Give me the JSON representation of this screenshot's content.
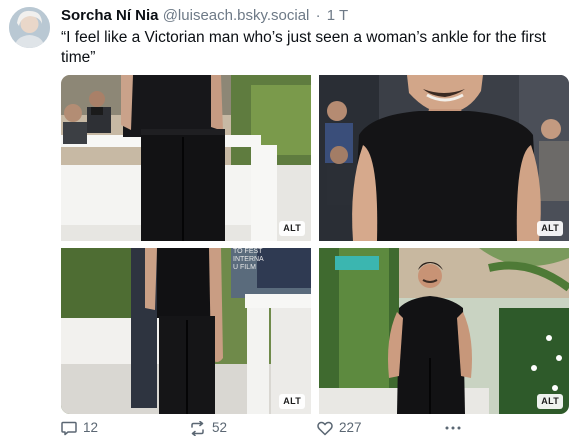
{
  "post": {
    "author": {
      "display_name": "Sorcha Ní Nia",
      "handle": "@luiseach.bsky.social",
      "separator": "·",
      "time": "1 T"
    },
    "text": "“I feel like a Victorian man who’s just seen a woman’s ankle for the first time”",
    "images": [
      {
        "alt_badge": "ALT"
      },
      {
        "alt_badge": "ALT"
      },
      {
        "alt_badge": "ALT"
      },
      {
        "alt_badge": "ALT"
      }
    ],
    "image_background_text": "TO FEST\nINTERNA\nU FILM",
    "actions": {
      "reply_count": "12",
      "repost_count": "52",
      "like_count": "227",
      "more_icon": "ellipsis-icon"
    }
  },
  "colors": {
    "text_primary": "#0b0f14",
    "text_secondary": "#6e7a87",
    "action_color": "#5b6773"
  }
}
